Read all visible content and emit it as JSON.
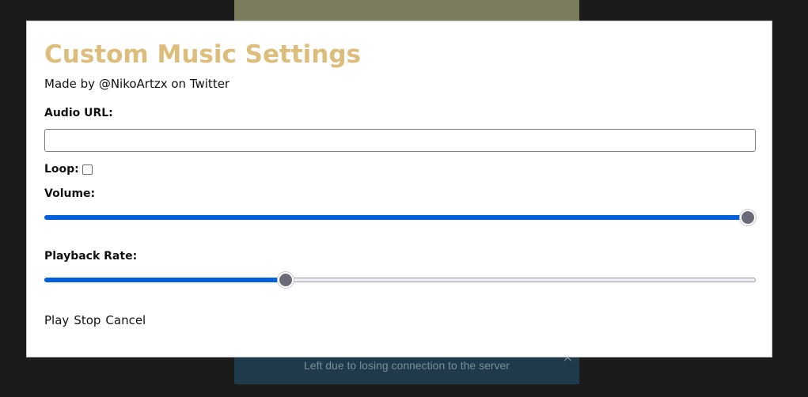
{
  "background": {
    "toast_text": "Left due to losing connection to the server",
    "toast_close": "×"
  },
  "modal": {
    "title": "Custom Music Settings",
    "credit": "Made by @NikoArtzx on Twitter",
    "audio_url": {
      "label": "Audio URL:",
      "value": "",
      "placeholder": ""
    },
    "loop": {
      "label": "Loop:",
      "checked": false
    },
    "volume": {
      "label": "Volume:",
      "value": 1.0
    },
    "playback_rate": {
      "label": "Playback Rate:",
      "value": 0.336
    },
    "actions": {
      "play": "Play",
      "stop": "Stop",
      "cancel": "Cancel"
    }
  },
  "colors": {
    "title": "#dcbd7b",
    "slider_fill": "#005fdb",
    "slider_thumb": "#6a6a78"
  }
}
